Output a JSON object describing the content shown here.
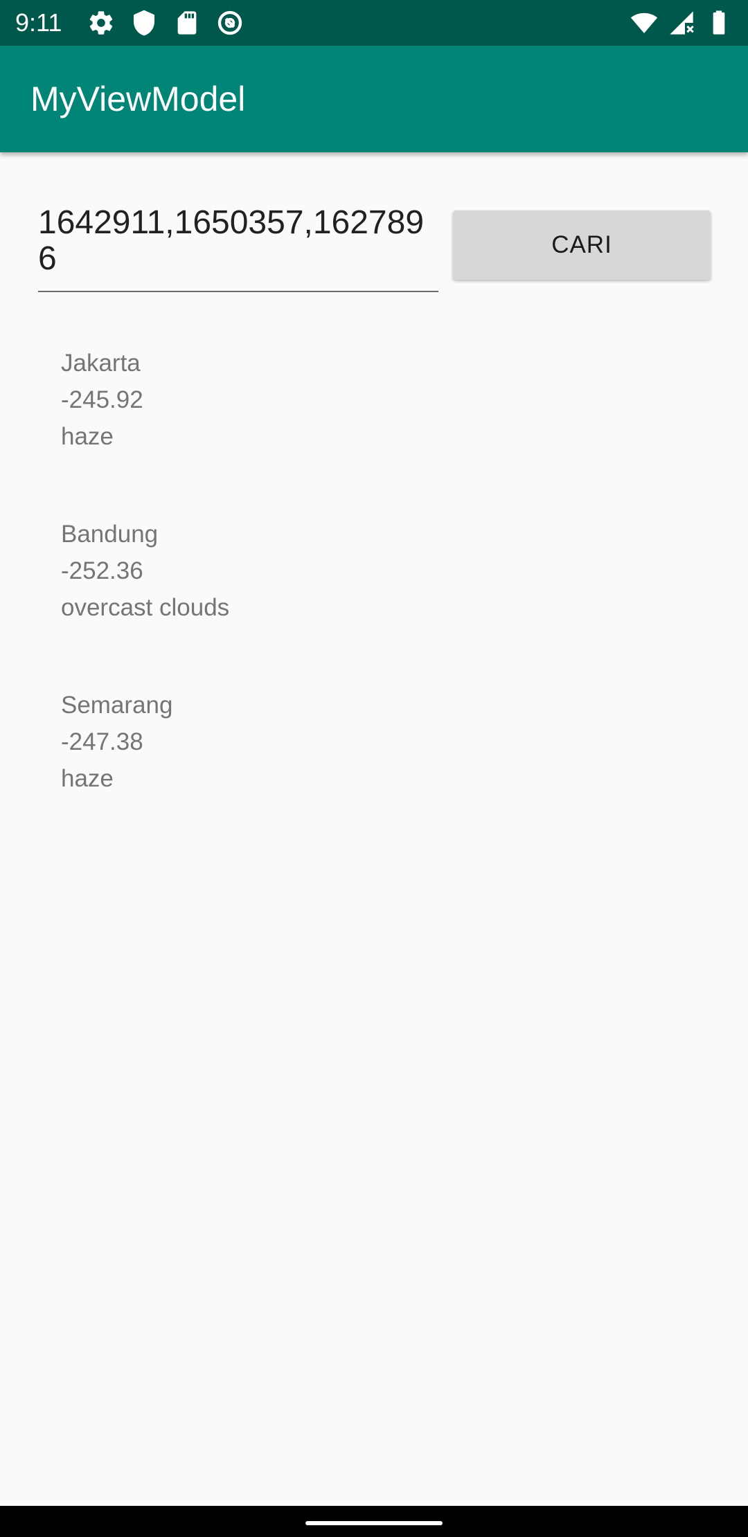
{
  "status_bar": {
    "time": "9:11",
    "icons_left": [
      "settings-icon",
      "shield-icon",
      "sd-card-icon",
      "sync-icon"
    ],
    "icons_right": [
      "wifi-icon",
      "cellular-no-data-icon",
      "battery-icon"
    ],
    "background": "#00574b"
  },
  "app_bar": {
    "title": "MyViewModel",
    "background": "#008577"
  },
  "search": {
    "input_value": "1642911,1650357,1627896",
    "button_label": "CARI"
  },
  "weather_items": [
    {
      "city": "Jakarta",
      "temperature": "-245.92",
      "description": "haze"
    },
    {
      "city": "Bandung",
      "temperature": "-252.36",
      "description": "overcast clouds"
    },
    {
      "city": "Semarang",
      "temperature": "-247.38",
      "description": "haze"
    }
  ]
}
